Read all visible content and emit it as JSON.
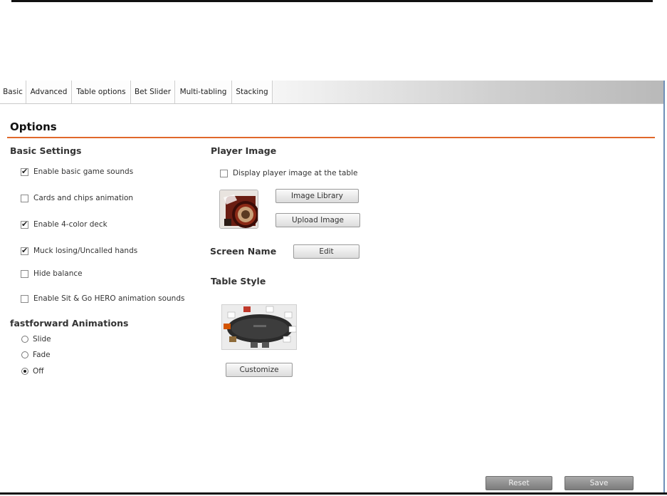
{
  "tabs": [
    {
      "label": "Basic",
      "active": true
    },
    {
      "label": "Advanced",
      "active": false
    },
    {
      "label": "Table options",
      "active": false
    },
    {
      "label": "Bet Slider",
      "active": false
    },
    {
      "label": "Multi-tabling",
      "active": false
    },
    {
      "label": "Stacking",
      "active": false
    }
  ],
  "heading": "Options",
  "basic_settings": {
    "title": "Basic Settings",
    "items": [
      {
        "label": "Enable basic game sounds",
        "checked": true
      },
      {
        "label": "Cards and chips animation",
        "checked": false
      },
      {
        "label": "Enable 4-color deck",
        "checked": true
      },
      {
        "label": "Muck losing/Uncalled hands",
        "checked": true
      },
      {
        "label": "Hide balance",
        "checked": false
      },
      {
        "label": "Enable Sit & Go HERO animation sounds",
        "checked": false
      }
    ]
  },
  "fastforward": {
    "title": "fastforward Animations",
    "options": [
      {
        "label": "Slide",
        "selected": false
      },
      {
        "label": "Fade",
        "selected": false
      },
      {
        "label": "Off",
        "selected": true
      }
    ]
  },
  "player_image": {
    "title": "Player Image",
    "display_label": "Display player image at the table",
    "display_checked": false,
    "library_button": "Image Library",
    "upload_button": "Upload Image"
  },
  "screen_name": {
    "title": "Screen Name",
    "edit_button": "Edit"
  },
  "table_style": {
    "title": "Table Style",
    "customize_button": "Customize"
  },
  "footer": {
    "reset_button": "Reset",
    "save_button": "Save"
  },
  "colors": {
    "accent_rule": "#e0682a",
    "dark_button": "#8a8a8a",
    "window_edge": "#6f8fb8"
  }
}
